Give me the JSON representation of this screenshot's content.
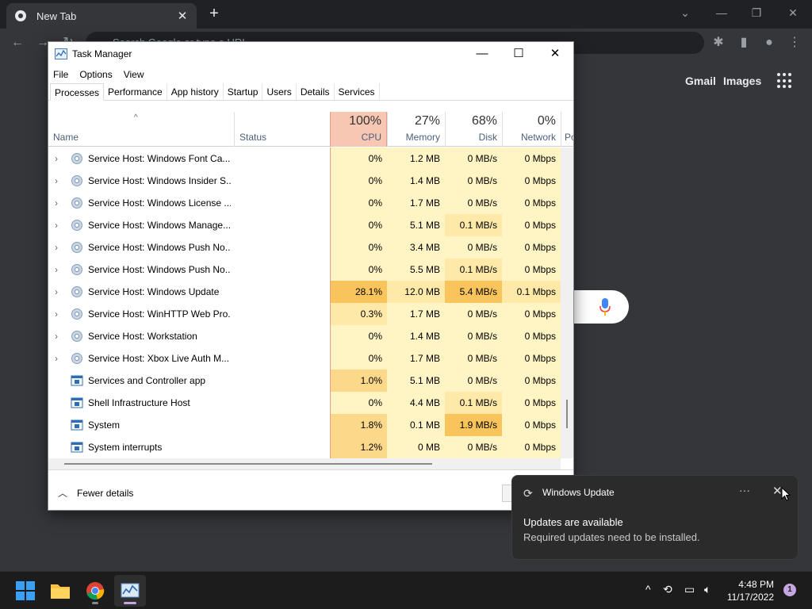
{
  "chrome": {
    "tab_title": "New Tab",
    "omnibox_placeholder": "Search Google or type a URL",
    "links": {
      "gmail": "Gmail",
      "images": "Images"
    }
  },
  "task_manager": {
    "title": "Task Manager",
    "menu": [
      "File",
      "Options",
      "View"
    ],
    "tabs": [
      "Processes",
      "Performance",
      "App history",
      "Startup",
      "Users",
      "Details",
      "Services"
    ],
    "active_tab": "Processes",
    "columns": {
      "name": "Name",
      "status": "Status",
      "cpu": {
        "pct": "100%",
        "label": "CPU"
      },
      "memory": {
        "pct": "27%",
        "label": "Memory"
      },
      "disk": {
        "pct": "68%",
        "label": "Disk"
      },
      "network": {
        "pct": "0%",
        "label": "Network"
      },
      "power_partial": "Po"
    },
    "rows": [
      {
        "name": "Service Host: Windows Font Ca...",
        "icon": "gear",
        "expand": true,
        "cpu": "0%",
        "memory": "1.2 MB",
        "disk": "0 MB/s",
        "network": "0 Mbps"
      },
      {
        "name": "Service Host: Windows Insider S...",
        "icon": "gear",
        "expand": true,
        "cpu": "0%",
        "memory": "1.4 MB",
        "disk": "0 MB/s",
        "network": "0 Mbps"
      },
      {
        "name": "Service Host: Windows License ...",
        "icon": "gear",
        "expand": true,
        "cpu": "0%",
        "memory": "1.7 MB",
        "disk": "0 MB/s",
        "network": "0 Mbps"
      },
      {
        "name": "Service Host: Windows Manage...",
        "icon": "gear",
        "expand": true,
        "cpu": "0%",
        "memory": "5.1 MB",
        "disk": "0.1 MB/s",
        "network": "0 Mbps"
      },
      {
        "name": "Service Host: Windows Push No...",
        "icon": "gear",
        "expand": true,
        "cpu": "0%",
        "memory": "3.4 MB",
        "disk": "0 MB/s",
        "network": "0 Mbps"
      },
      {
        "name": "Service Host: Windows Push No...",
        "icon": "gear",
        "expand": true,
        "cpu": "0%",
        "memory": "5.5 MB",
        "disk": "0.1 MB/s",
        "network": "0 Mbps"
      },
      {
        "name": "Service Host: Windows Update",
        "icon": "gear",
        "expand": true,
        "cpu": "28.1%",
        "memory": "12.0 MB",
        "disk": "5.4 MB/s",
        "network": "0.1 Mbps"
      },
      {
        "name": "Service Host: WinHTTP Web Pro...",
        "icon": "gear",
        "expand": true,
        "cpu": "0.3%",
        "memory": "1.7 MB",
        "disk": "0 MB/s",
        "network": "0 Mbps"
      },
      {
        "name": "Service Host: Workstation",
        "icon": "gear",
        "expand": true,
        "cpu": "0%",
        "memory": "1.4 MB",
        "disk": "0 MB/s",
        "network": "0 Mbps"
      },
      {
        "name": "Service Host: Xbox Live Auth M...",
        "icon": "gear",
        "expand": true,
        "cpu": "0%",
        "memory": "1.7 MB",
        "disk": "0 MB/s",
        "network": "0 Mbps"
      },
      {
        "name": "Services and Controller app",
        "icon": "window",
        "expand": false,
        "cpu": "1.0%",
        "memory": "5.1 MB",
        "disk": "0 MB/s",
        "network": "0 Mbps"
      },
      {
        "name": "Shell Infrastructure Host",
        "icon": "window",
        "expand": false,
        "cpu": "0%",
        "memory": "4.4 MB",
        "disk": "0.1 MB/s",
        "network": "0 Mbps"
      },
      {
        "name": "System",
        "icon": "window",
        "expand": false,
        "cpu": "1.8%",
        "memory": "0.1 MB",
        "disk": "1.9 MB/s",
        "network": "0 Mbps"
      },
      {
        "name": "System interrupts",
        "icon": "window",
        "expand": false,
        "cpu": "1.2%",
        "memory": "0 MB",
        "disk": "0 MB/s",
        "network": "0 Mbps"
      }
    ],
    "footer": {
      "fewer_details": "Fewer details"
    }
  },
  "notification": {
    "app": "Windows Update",
    "heading": "Updates are available",
    "body": "Required updates need to be installed."
  },
  "taskbar": {
    "time": "4:48 PM",
    "date": "11/17/2022",
    "notification_count": "1"
  }
}
